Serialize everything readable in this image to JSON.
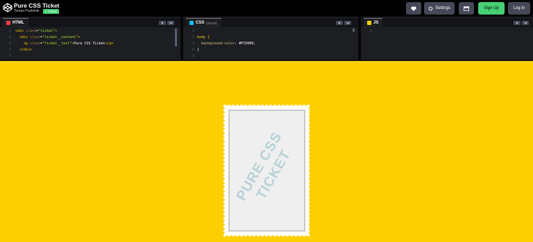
{
  "header": {
    "title": "Pure CSS Ticket",
    "author": "Tomas Pustelnik",
    "follow_label": "+ Follow",
    "settings_label": "Settings",
    "signup_label": "Sign Up",
    "login_label": "Log In"
  },
  "editors": {
    "html": {
      "tab_label": "HTML",
      "line_numbers": [
        "1",
        "2",
        "3",
        "4",
        "5"
      ],
      "lines": [
        {
          "tag_open": "<div ",
          "attr": "class",
          "eq": "=",
          "str": "\"ticket\"",
          "tag_close": ">"
        },
        {
          "tag_open": "  <div ",
          "attr": "class",
          "eq": "=",
          "str": "\"ticket__content\"",
          "tag_close": ">"
        },
        {
          "tag_open": "    <p ",
          "attr": "class",
          "eq": "=",
          "str": "\"ticket__text\"",
          "tag_close": ">",
          "text": "Pure CSS Ticket",
          "end": "</p>"
        },
        {
          "tag_open": "  </div>"
        }
      ]
    },
    "css": {
      "tab_label": "CSS",
      "tab_sub": "(SCSS)",
      "line_numbers": [
        "1",
        "2",
        "3",
        "4",
        "5"
      ],
      "selector": "body {",
      "property": "background-color",
      "value": "#FCD000;",
      "close": "}"
    },
    "js": {
      "tab_label": "JS",
      "line_numbers": [
        "1"
      ]
    }
  },
  "preview": {
    "background_color": "#FCD000",
    "ticket_text": "PURE CSS\nTICKET"
  },
  "colors": {
    "follow": "#47cf73",
    "signup": "#47cf73",
    "button": "#444857",
    "html_icon": "#ff3c41",
    "css_icon": "#0ebeff",
    "js_icon": "#fcd000"
  }
}
